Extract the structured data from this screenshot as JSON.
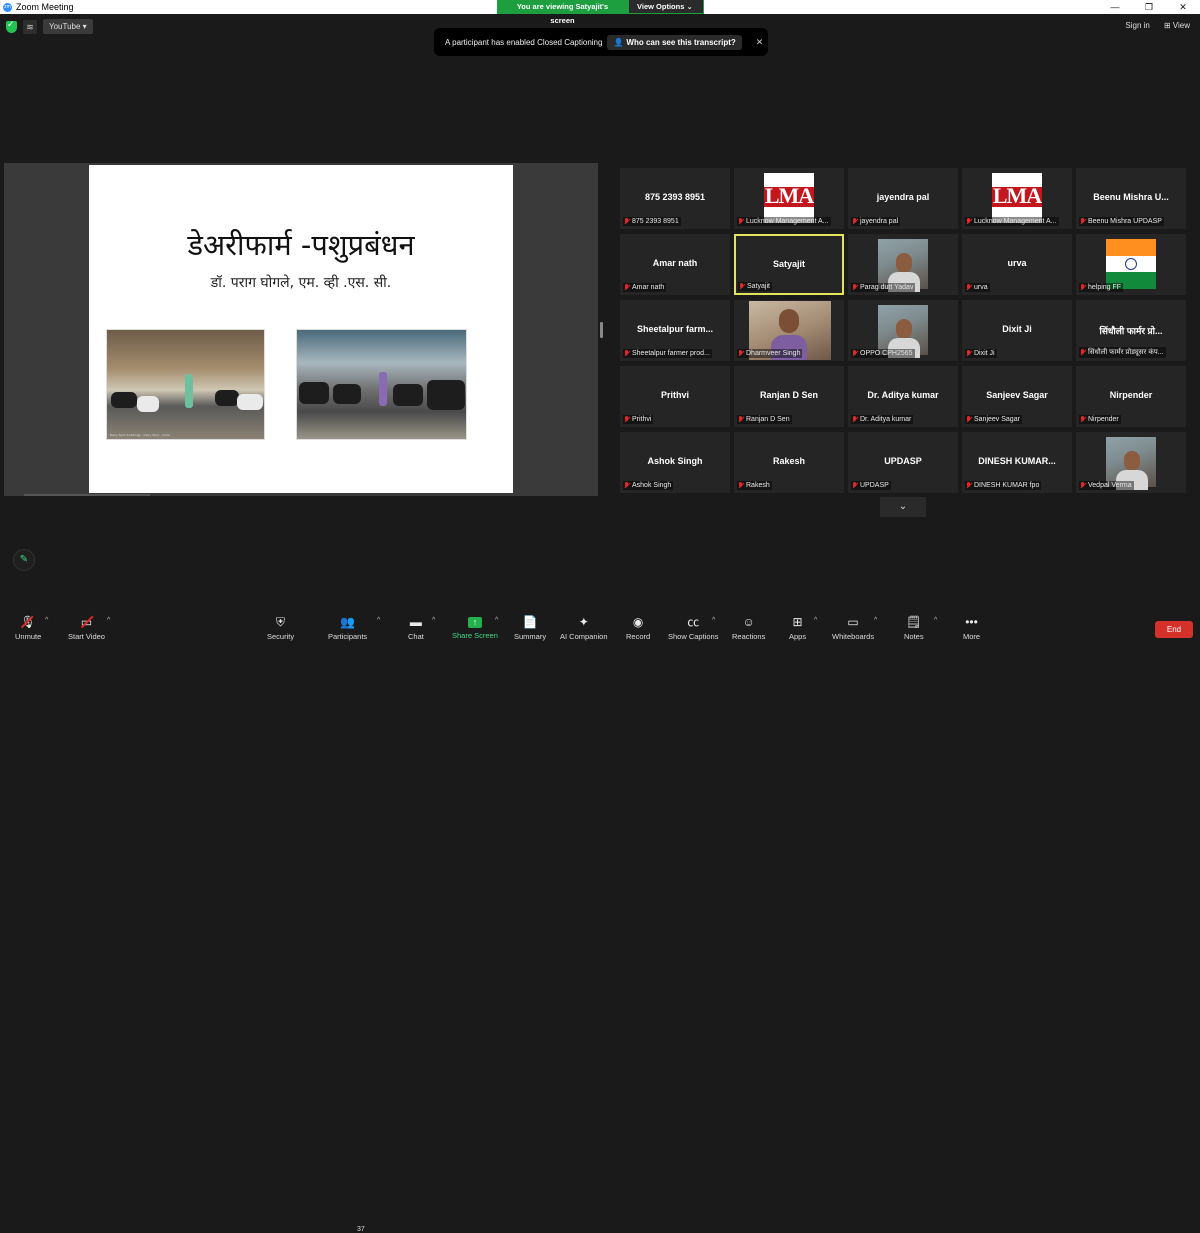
{
  "window": {
    "title": "Zoom Meeting",
    "controls": [
      "—",
      "❐",
      "✕"
    ]
  },
  "banner": {
    "viewing_text": "You are viewing Satyajit's screen",
    "view_options": "View Options ⌄"
  },
  "topbar": {
    "youtube": "YouTube ▾",
    "sign_in": "Sign in",
    "view": "View"
  },
  "caption_toast": {
    "message": "A participant has enabled Closed Captioning",
    "who_button": "Who can see this transcript?",
    "close": "✕"
  },
  "slide": {
    "title": "डेअरीफार्म -पशुप्रबंधन",
    "subtitle": "डॉ. पराग घोगले, एम. व्ही .एस. सी.",
    "photo1_caption": "Dairy farm buildings - Dairy farm - India"
  },
  "participants": [
    {
      "name": "875 2393 8951",
      "label": "875 2393 8951",
      "pic": "none"
    },
    {
      "name": "",
      "label": "Lucknow Management A...",
      "pic": "lma"
    },
    {
      "name": "jayendra pal",
      "label": "jayendra pal",
      "pic": "none"
    },
    {
      "name": "",
      "label": "Lucknow Management A...",
      "pic": "lma"
    },
    {
      "name": "Beenu Mishra U...",
      "label": "Beenu Mishra UPDASP",
      "pic": "none"
    },
    {
      "name": "Amar nath",
      "label": "Amar nath",
      "pic": "none"
    },
    {
      "name": "Satyajit",
      "label": "Satyajit",
      "pic": "none",
      "active": true
    },
    {
      "name": "",
      "label": "Parag dutt Yadav",
      "pic": "video"
    },
    {
      "name": "urva",
      "label": "urva",
      "pic": "none"
    },
    {
      "name": "",
      "label": "helping FF",
      "pic": "flag"
    },
    {
      "name": "Sheetalpur farm...",
      "label": "Sheetalpur farmer prod...",
      "pic": "none"
    },
    {
      "name": "",
      "label": "Dharmveer Singh",
      "pic": "video-wide"
    },
    {
      "name": "",
      "label": "OPPO CPH2565",
      "pic": "video"
    },
    {
      "name": "Dixit Ji",
      "label": "Dixit Ji",
      "pic": "none"
    },
    {
      "name": "सिंधौली फार्मर प्रो...",
      "label": "सिंधौली फार्मर प्रोड्यूसर कंप...",
      "pic": "none"
    },
    {
      "name": "Prithvi",
      "label": "Prithvi",
      "pic": "none"
    },
    {
      "name": "Ranjan D Sen",
      "label": "Ranjan D Sen",
      "pic": "none"
    },
    {
      "name": "Dr. Aditya kumar",
      "label": "Dr. Aditya kumar",
      "pic": "none"
    },
    {
      "name": "Sanjeev Sagar",
      "label": "Sanjeev Sagar",
      "pic": "none"
    },
    {
      "name": "Nirpender",
      "label": "Nirpender",
      "pic": "none"
    },
    {
      "name": "Ashok Singh",
      "label": "Ashok Singh",
      "pic": "none"
    },
    {
      "name": "Rakesh",
      "label": "Rakesh",
      "pic": "none"
    },
    {
      "name": "UPDASP",
      "label": "UPDASP",
      "pic": "none"
    },
    {
      "name": "DINESH KUMAR...",
      "label": "DINESH KUMAR fpo",
      "pic": "none"
    },
    {
      "name": "",
      "label": "Vedpal Verma",
      "pic": "video"
    }
  ],
  "lma_text": "LMA",
  "toolbar": {
    "unmute": "Unmute",
    "start_video": "Start Video",
    "security": "Security",
    "participants": "Participants",
    "participants_count": "37",
    "chat": "Chat",
    "share_screen": "Share Screen",
    "summary": "Summary",
    "ai_companion": "AI Companion",
    "record": "Record",
    "show_captions": "Show Captions",
    "reactions": "Reactions",
    "apps": "Apps",
    "whiteboards": "Whiteboards",
    "notes": "Notes",
    "more": "More",
    "end": "End"
  },
  "colors": {
    "accent_green": "#1d9e3f",
    "end_red": "#d6302a",
    "active_speaker": "#e2e45c"
  }
}
